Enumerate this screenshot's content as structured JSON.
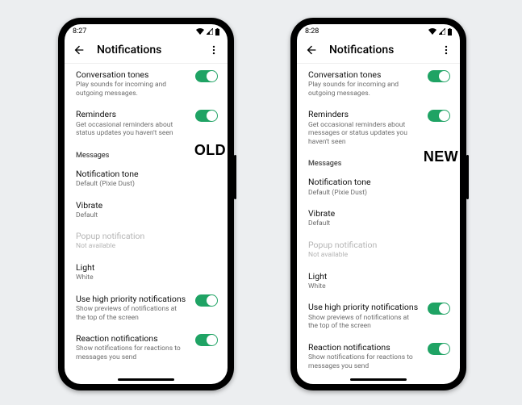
{
  "phones": [
    {
      "badge": "OLD",
      "statusbar": {
        "time": "8:27"
      },
      "appbar": {
        "title": "Notifications"
      },
      "settings": {
        "conversation_tones": {
          "title": "Conversation tones",
          "sub": "Play sounds for incoming and outgoing messages.",
          "on": true
        },
        "reminders": {
          "title": "Reminders",
          "sub": "Get occasional reminders about status updates you haven't seen",
          "on": true
        },
        "section_messages": "Messages",
        "notification_tone": {
          "title": "Notification tone",
          "sub": "Default (Pixie Dust)"
        },
        "vibrate": {
          "title": "Vibrate",
          "sub": "Default"
        },
        "popup": {
          "title": "Popup notification",
          "sub": "Not available"
        },
        "light": {
          "title": "Light",
          "sub": "White"
        },
        "high_priority": {
          "title": "Use high priority notifications",
          "sub": "Show previews of notifications at the top of the screen",
          "on": true
        },
        "reaction": {
          "title": "Reaction notifications",
          "sub": "Show notifications for reactions to messages you send",
          "on": true
        }
      }
    },
    {
      "badge": "NEW",
      "statusbar": {
        "time": "8:28"
      },
      "appbar": {
        "title": "Notifications"
      },
      "settings": {
        "conversation_tones": {
          "title": "Conversation tones",
          "sub": "Play sounds for incoming and outgoing messages.",
          "on": true
        },
        "reminders": {
          "title": "Reminders",
          "sub": "Get occasional reminders about messages or status updates you haven't seen",
          "on": true
        },
        "section_messages": "Messages",
        "notification_tone": {
          "title": "Notification tone",
          "sub": "Default (Pixie Dust)"
        },
        "vibrate": {
          "title": "Vibrate",
          "sub": "Default"
        },
        "popup": {
          "title": "Popup notification",
          "sub": "Not available"
        },
        "light": {
          "title": "Light",
          "sub": "White"
        },
        "high_priority": {
          "title": "Use high priority notifications",
          "sub": "Show previews of notifications at the top of the screen",
          "on": true
        },
        "reaction": {
          "title": "Reaction notifications",
          "sub": "Show notifications for reactions to messages you send",
          "on": true
        }
      }
    }
  ]
}
